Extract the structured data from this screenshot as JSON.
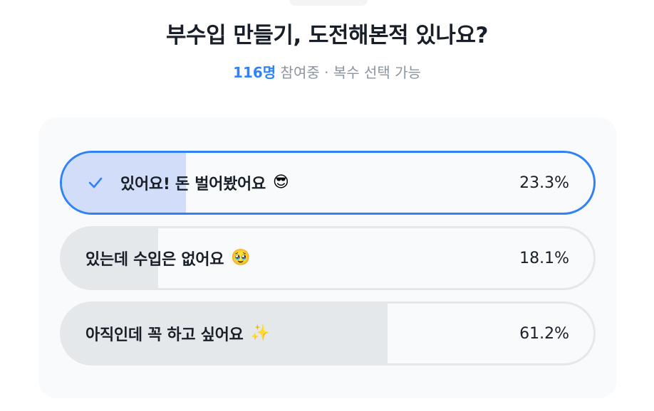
{
  "poll": {
    "title": "부수입 만들기, 도전해본적 있나요?",
    "participants": "116명",
    "subtitle_rest": " 참여중 · 복수 선택 가능",
    "options": [
      {
        "label": "있어요! 돈 벌어봤어요",
        "emoji": "😎",
        "percent_text": "23.3%",
        "fraction": 0.233,
        "selected": true
      },
      {
        "label": "있는데 수입은 없어요",
        "emoji": "🥹",
        "percent_text": "18.1%",
        "fraction": 0.181,
        "selected": false
      },
      {
        "label": "아직인데 꼭 하고 싶어요",
        "emoji": "✨",
        "percent_text": "61.2%",
        "fraction": 0.612,
        "selected": false
      }
    ]
  },
  "colors": {
    "accent": "#3182f6",
    "selected_fill": "#d1ddf9",
    "fill": "#e5e8eb",
    "card_bg": "#f9fafb",
    "text": "#191f28",
    "muted": "#8b95a1"
  }
}
